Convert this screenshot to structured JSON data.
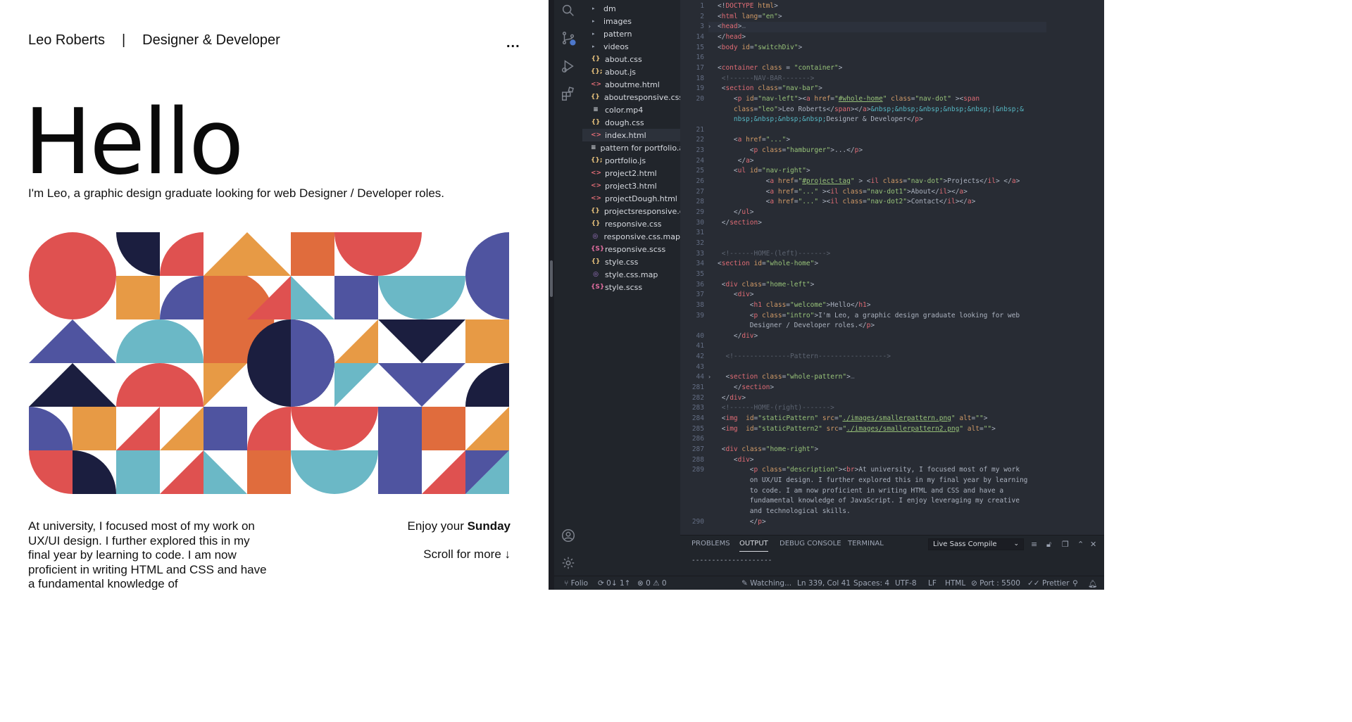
{
  "site": {
    "nav_name": "Leo Roberts",
    "nav_sep": "|",
    "nav_role": "Designer & Developer",
    "nav_more": "...",
    "hello": "Hello",
    "intro": "I'm Leo, a graphic design graduate looking for web Designer / Developer roles.",
    "description": "At university, I focused most of my work on UX/UI design. I further explored this in my final year by learning to code. I am now proficient in writing HTML and CSS and have a fundamental knowledge of",
    "enjoy_prefix": "Enjoy your ",
    "enjoy_day": "Sunday",
    "scroll": "Scroll for more ↓",
    "pattern_colors": {
      "red": "#df5150",
      "navy": "#1b1e3f",
      "blue": "#4f54a0",
      "orange": "#e79a45",
      "teal": "#6bb8c6",
      "rust": "#e06c3d"
    }
  },
  "explorer": {
    "items": [
      {
        "kind": "folder",
        "name": "dm"
      },
      {
        "kind": "folder",
        "name": "images"
      },
      {
        "kind": "folder",
        "name": "pattern"
      },
      {
        "kind": "folder",
        "name": "videos"
      },
      {
        "kind": "css",
        "name": "about.css"
      },
      {
        "kind": "js",
        "name": "about.js"
      },
      {
        "kind": "html",
        "name": "aboutme.html"
      },
      {
        "kind": "css",
        "name": "aboutresponsive.css"
      },
      {
        "kind": "file",
        "name": "color.mp4"
      },
      {
        "kind": "css",
        "name": "dough.css"
      },
      {
        "kind": "html",
        "name": "index.html",
        "active": true
      },
      {
        "kind": "file",
        "name": "pattern for portfolio.ai"
      },
      {
        "kind": "js",
        "name": "portfolio.js"
      },
      {
        "kind": "html",
        "name": "project2.html"
      },
      {
        "kind": "html",
        "name": "project3.html"
      },
      {
        "kind": "html",
        "name": "projectDough.html"
      },
      {
        "kind": "css",
        "name": "projectsresponsive.c..."
      },
      {
        "kind": "css",
        "name": "responsive.css"
      },
      {
        "kind": "map",
        "name": "responsive.css.map"
      },
      {
        "kind": "scss",
        "name": "responsive.scss"
      },
      {
        "kind": "css",
        "name": "style.css"
      },
      {
        "kind": "map",
        "name": "style.css.map"
      },
      {
        "kind": "scss",
        "name": "style.scss"
      }
    ]
  },
  "editor": {
    "lines": [
      {
        "n": "1",
        "html": "<span class=\"p\">&lt;!</span><span class=\"t\">DOCTYPE</span> <span class=\"a\">html</span><span class=\"p\">&gt;</span>"
      },
      {
        "n": "2",
        "html": "<span class=\"p\">&lt;</span><span class=\"t\">html</span> <span class=\"a\">lang</span>=<span class=\"s\">\"en\"</span><span class=\"p\">&gt;</span>"
      },
      {
        "n": "3",
        "html": "<span class=\"p\">&lt;</span><span class=\"t\">head</span><span class=\"p\">&gt;</span><span class=\"c\">…</span>",
        "fold": true
      },
      {
        "n": "14",
        "html": "<span class=\"p\">&lt;/</span><span class=\"t\">head</span><span class=\"p\">&gt;</span>"
      },
      {
        "n": "15",
        "html": "<span class=\"p\">&lt;</span><span class=\"t\">body</span> <span class=\"a\">id</span>=<span class=\"s\">\"switchDiv\"</span><span class=\"p\">&gt;</span>"
      },
      {
        "n": "16",
        "html": ""
      },
      {
        "n": "17",
        "html": "<span class=\"p\">&lt;</span><span class=\"t\">container</span> <span class=\"a\">class</span> = <span class=\"s\">\"container\"</span><span class=\"p\">&gt;</span>"
      },
      {
        "n": "18",
        "html": " <span class=\"c\">&lt;!------NAV-BAR-------&gt;</span>"
      },
      {
        "n": "19",
        "html": " <span class=\"p\">&lt;</span><span class=\"t\">section</span> <span class=\"a\">class</span>=<span class=\"s\">\"nav-bar\"</span><span class=\"p\">&gt;</span>"
      },
      {
        "n": "20",
        "html": "    <span class=\"p\">&lt;</span><span class=\"t\">p</span> <span class=\"a\">id</span>=<span class=\"s\">\"nav-left\"</span><span class=\"p\">&gt;&lt;</span><span class=\"t\">a</span> <span class=\"a\">href</span>=<span class=\"s\">\"</span><span class=\"u\">#whole-home</span><span class=\"s\">\"</span> <span class=\"a\">class</span>=<span class=\"s\">\"nav-dot\"</span> <span class=\"p\">&gt;&lt;</span><span class=\"t\">span</span>"
      },
      {
        "n": "",
        "html": "    <span class=\"a\">class</span>=<span class=\"s\">\"leo\"</span><span class=\"p\">&gt;</span>Leo Roberts<span class=\"p\">&lt;/</span><span class=\"t\">span</span><span class=\"p\">&gt;&lt;/</span><span class=\"t\">a</span><span class=\"p\">&gt;</span><span class=\"e\">&amp;nbsp;&amp;nbsp;&amp;nbsp;&amp;nbsp;&amp;nbsp;</span>|<span class=\"e\">&amp;nbsp;&amp;</span>"
      },
      {
        "n": "",
        "html": "    <span class=\"e\">nbsp;&amp;nbsp;&amp;nbsp;&amp;nbsp;</span>Designer &amp; Developer<span class=\"p\">&lt;/</span><span class=\"t\">p</span><span class=\"p\">&gt;</span>"
      },
      {
        "n": "21",
        "html": ""
      },
      {
        "n": "22",
        "html": "    <span class=\"p\">&lt;</span><span class=\"t\">a</span> <span class=\"a\">href</span>=<span class=\"s\">\"...\"</span><span class=\"p\">&gt;</span>"
      },
      {
        "n": "23",
        "html": "        <span class=\"p\">&lt;</span><span class=\"t\">p</span> <span class=\"a\">class</span>=<span class=\"s\">\"hamburger\"</span><span class=\"p\">&gt;</span>...<span class=\"p\">&lt;/</span><span class=\"t\">p</span><span class=\"p\">&gt;</span>"
      },
      {
        "n": "24",
        "html": "     <span class=\"p\">&lt;/</span><span class=\"t\">a</span><span class=\"p\">&gt;</span>"
      },
      {
        "n": "25",
        "html": "    <span class=\"p\">&lt;</span><span class=\"t\">ul</span> <span class=\"a\">id</span>=<span class=\"s\">\"nav-right\"</span><span class=\"p\">&gt;</span>"
      },
      {
        "n": "26",
        "html": "            <span class=\"p\">&lt;</span><span class=\"t\">a</span> <span class=\"a\">href</span>=<span class=\"s\">\"</span><span class=\"u\">#project-tag</span><span class=\"s\">\"</span> <span class=\"p\">&gt;</span> <span class=\"p\">&lt;</span><span class=\"t\">il</span> <span class=\"a\">class</span>=<span class=\"s\">\"nav-dot\"</span><span class=\"p\">&gt;</span>Projects<span class=\"p\">&lt;/</span><span class=\"t\">il</span><span class=\"p\">&gt;</span> <span class=\"p\">&lt;/</span><span class=\"t\">a</span><span class=\"p\">&gt;</span>"
      },
      {
        "n": "27",
        "html": "            <span class=\"p\">&lt;</span><span class=\"t\">a</span> <span class=\"a\">href</span>=<span class=\"s\">\"...\"</span> <span class=\"p\">&gt;&lt;</span><span class=\"t\">il</span> <span class=\"a\">class</span>=<span class=\"s\">\"nav-dot1\"</span><span class=\"p\">&gt;</span>About<span class=\"p\">&lt;/</span><span class=\"t\">il</span><span class=\"p\">&gt;&lt;/</span><span class=\"t\">a</span><span class=\"p\">&gt;</span>"
      },
      {
        "n": "28",
        "html": "            <span class=\"p\">&lt;</span><span class=\"t\">a</span> <span class=\"a\">href</span>=<span class=\"s\">\"...\"</span> <span class=\"p\">&gt;&lt;</span><span class=\"t\">il</span> <span class=\"a\">class</span>=<span class=\"s\">\"nav-dot2\"</span><span class=\"p\">&gt;</span>Contact<span class=\"p\">&lt;/</span><span class=\"t\">il</span><span class=\"p\">&gt;&lt;/</span><span class=\"t\">a</span><span class=\"p\">&gt;</span>"
      },
      {
        "n": "29",
        "html": "    <span class=\"p\">&lt;/</span><span class=\"t\">ul</span><span class=\"p\">&gt;</span>"
      },
      {
        "n": "30",
        "html": " <span class=\"p\">&lt;/</span><span class=\"t\">section</span><span class=\"p\">&gt;</span>"
      },
      {
        "n": "31",
        "html": ""
      },
      {
        "n": "32",
        "html": ""
      },
      {
        "n": "33",
        "html": " <span class=\"c\">&lt;!------HOME-(left)-------&gt;</span>"
      },
      {
        "n": "34",
        "html": "<span class=\"p\">&lt;</span><span class=\"t\">section</span> <span class=\"a\">id</span>=<span class=\"s\">\"whole-home\"</span><span class=\"p\">&gt;</span>"
      },
      {
        "n": "35",
        "html": ""
      },
      {
        "n": "36",
        "html": " <span class=\"p\">&lt;</span><span class=\"t\">div</span> <span class=\"a\">class</span>=<span class=\"s\">\"home-left\"</span><span class=\"p\">&gt;</span>"
      },
      {
        "n": "37",
        "html": "    <span class=\"p\">&lt;</span><span class=\"t\">div</span><span class=\"p\">&gt;</span>"
      },
      {
        "n": "38",
        "html": "        <span class=\"p\">&lt;</span><span class=\"t\">h1</span> <span class=\"a\">class</span>=<span class=\"s\">\"welcome\"</span><span class=\"p\">&gt;</span>Hello<span class=\"p\">&lt;/</span><span class=\"t\">h1</span><span class=\"p\">&gt;</span>"
      },
      {
        "n": "39",
        "html": "        <span class=\"p\">&lt;</span><span class=\"t\">p</span> <span class=\"a\">class</span>=<span class=\"s\">\"intro\"</span><span class=\"p\">&gt;</span>I'm Leo, a graphic design graduate looking for web"
      },
      {
        "n": "",
        "html": "        Designer / Developer roles.<span class=\"p\">&lt;/</span><span class=\"t\">p</span><span class=\"p\">&gt;</span>"
      },
      {
        "n": "40",
        "html": "    <span class=\"p\">&lt;/</span><span class=\"t\">div</span><span class=\"p\">&gt;</span>"
      },
      {
        "n": "41",
        "html": ""
      },
      {
        "n": "42",
        "html": "  <span class=\"c\">&lt;!--------------Pattern-----------------&gt;</span>"
      },
      {
        "n": "43",
        "html": ""
      },
      {
        "n": "44",
        "html": "  <span class=\"p\">&lt;</span><span class=\"t\">section</span> <span class=\"a\">class</span>=<span class=\"s\">\"whole-pattern\"</span><span class=\"p\">&gt;</span><span class=\"c\">…</span>",
        "fold": true
      },
      {
        "n": "281",
        "html": "    <span class=\"p\">&lt;/</span><span class=\"t\">section</span><span class=\"p\">&gt;</span>"
      },
      {
        "n": "282",
        "html": " <span class=\"p\">&lt;/</span><span class=\"t\">div</span><span class=\"p\">&gt;</span>"
      },
      {
        "n": "283",
        "html": " <span class=\"c\">&lt;!------HOME-(right)-------&gt;</span>"
      },
      {
        "n": "284",
        "html": " <span class=\"p\">&lt;</span><span class=\"t\">img</span>  <span class=\"a\">id</span>=<span class=\"s\">\"staticPattern\"</span> <span class=\"a\">src</span>=<span class=\"s\">\"</span><span class=\"u\">./images/smallerpattern.png</span><span class=\"s\">\"</span> <span class=\"a\">alt</span>=<span class=\"s\">\"\"</span><span class=\"p\">&gt;</span>"
      },
      {
        "n": "285",
        "html": " <span class=\"p\">&lt;</span><span class=\"t\">img</span>  <span class=\"a\">id</span>=<span class=\"s\">\"staticPattern2\"</span> <span class=\"a\">src</span>=<span class=\"s\">\"</span><span class=\"u\">./images/smallerpattern2.png</span><span class=\"s\">\"</span> <span class=\"a\">alt</span>=<span class=\"s\">\"\"</span><span class=\"p\">&gt;</span>"
      },
      {
        "n": "286",
        "html": ""
      },
      {
        "n": "287",
        "html": " <span class=\"p\">&lt;</span><span class=\"t\">div</span> <span class=\"a\">class</span>=<span class=\"s\">\"home-right\"</span><span class=\"p\">&gt;</span>"
      },
      {
        "n": "288",
        "html": "    <span class=\"p\">&lt;</span><span class=\"t\">div</span><span class=\"p\">&gt;</span>"
      },
      {
        "n": "289",
        "html": "        <span class=\"p\">&lt;</span><span class=\"t\">p</span> <span class=\"a\">class</span>=<span class=\"s\">\"description\"</span><span class=\"p\">&gt;&lt;</span><span class=\"t\">br</span><span class=\"p\">&gt;</span>At university, I focused most of my work"
      },
      {
        "n": "",
        "html": "        on UX/UI design. I further explored this in my final year by learning"
      },
      {
        "n": "",
        "html": "        to code. I am now proficient in writing HTML and CSS and have a"
      },
      {
        "n": "",
        "html": "        fundamental knowledge of JavaScript. I enjoy leveraging my creative"
      },
      {
        "n": "",
        "html": "        and technological skills."
      },
      {
        "n": "290",
        "html": "        <span class=\"p\">&lt;/</span><span class=\"t\">p</span><span class=\"p\">&gt;</span>"
      }
    ]
  },
  "panel": {
    "tabs": [
      "PROBLEMS",
      "OUTPUT",
      "DEBUG CONSOLE",
      "TERMINAL"
    ],
    "active_tab": "OUTPUT",
    "output_channel": "Live Sass Compile",
    "output_line": "--------------------"
  },
  "status": {
    "branch": "Folio",
    "sync": "0↓ 1↑",
    "errors": "0",
    "warnings": "0",
    "watching": "Watching...",
    "position": "Ln 339, Col 41",
    "spaces": "Spaces: 4",
    "encoding": "UTF-8",
    "eol": "LF",
    "language": "HTML",
    "port": "Port : 5500",
    "prettier": "Prettier"
  },
  "colors": {
    "editor_bg": "#282c34",
    "sidebar_bg": "#21252b",
    "accent_blue": "#4d78cc"
  }
}
